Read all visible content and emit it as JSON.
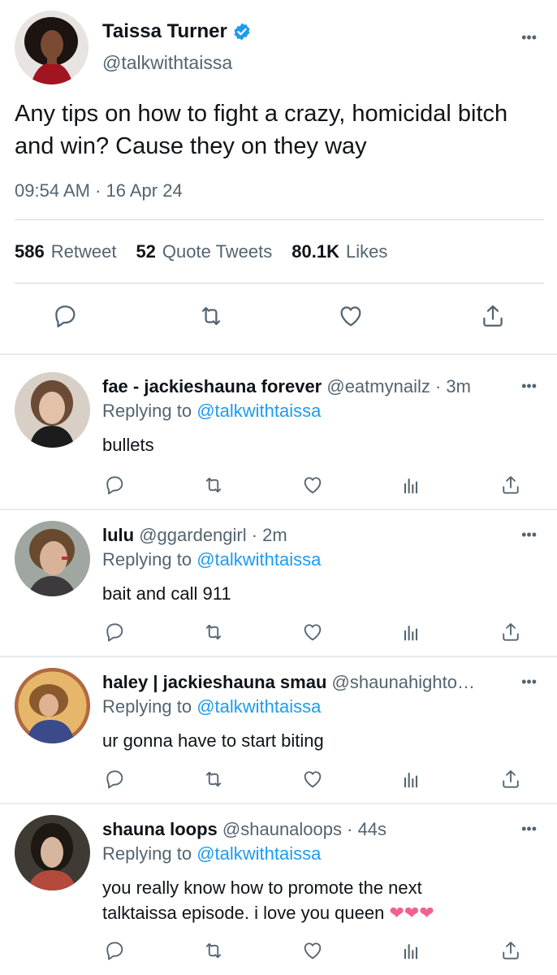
{
  "main": {
    "name": "Taissa Turner",
    "handle": "@talkwithtaissa",
    "text": "Any tips on how to fight a crazy, homicidal bitch and win? Cause they on they way",
    "time": "09:54 AM · 16 Apr 24",
    "stats": {
      "retweets_count": "586",
      "retweets_label": "Retweet",
      "quotes_count": "52",
      "quotes_label": "Quote Tweets",
      "likes_count": "80.1K",
      "likes_label": "Likes"
    },
    "more": "•••"
  },
  "replies": [
    {
      "name": "fae - jackieshauna forever",
      "meta": " @eatmynailz · 3m",
      "replying_prefix": "Replying to ",
      "replying_handle": "@talkwithtaissa",
      "text": "bullets",
      "more": "•••"
    },
    {
      "name": "lulu",
      "meta": "  @ggardengirl · 2m",
      "replying_prefix": "Replying to ",
      "replying_handle": "@talkwithtaissa",
      "text": "bait and call 911",
      "more": "•••"
    },
    {
      "name": "haley | jackieshauna smau",
      "meta": " @shaunahighto…",
      "replying_prefix": "Replying to ",
      "replying_handle": "@talkwithtaissa",
      "text": "ur gonna have to start biting",
      "more": "•••"
    },
    {
      "name": "shauna loops",
      "meta": " @shaunaloops · 44s",
      "replying_prefix": "Replying to ",
      "replying_handle": "@talkwithtaissa",
      "text_line1": "you really know how to promote the next",
      "text_line2": "talktaissa episode. i love you queen ",
      "hearts": "❤❤❤",
      "more": "•••"
    }
  ],
  "icons": {
    "reply": "reply-icon",
    "retweet": "retweet-icon",
    "like": "heart-icon",
    "analytics": "analytics-icon",
    "share": "share-icon",
    "verified": "verified-badge-icon"
  },
  "colors": {
    "link": "#1d9bf0",
    "secondary_text": "#536471",
    "divider": "#cfd9de",
    "verified": "#1d9bf0"
  }
}
